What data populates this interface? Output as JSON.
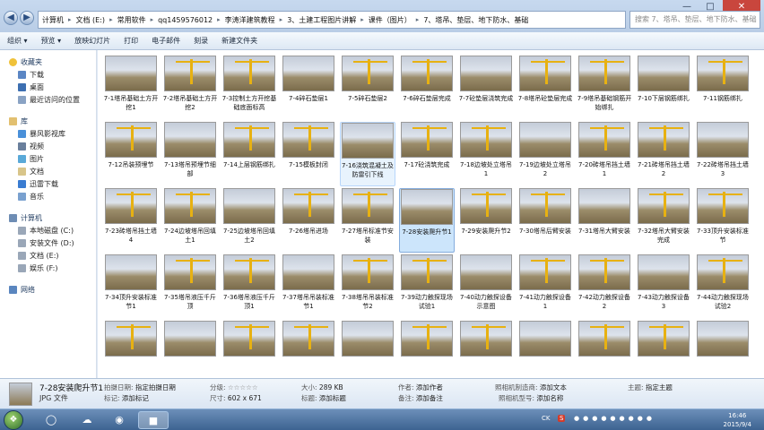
{
  "titlebar": {
    "crumbs": [
      "计算机",
      "文档 (E:)",
      "常用软件",
      "qq1459576012",
      "李涛洋建筑教程",
      "3、土建工程图片讲解",
      "课件（图片）",
      "7、塔吊、垫层、地下防水、基础"
    ],
    "search_placeholder": "搜索 7、塔吊、垫层、地下防水、基础",
    "back_icon": "back-arrow-icon",
    "forward_icon": "forward-arrow-icon"
  },
  "toolbar": {
    "items": [
      "组织 ▾",
      "预览 ▾",
      "放映幻灯片",
      "打印",
      "电子邮件",
      "刻录",
      "新建文件夹"
    ]
  },
  "sidebar": {
    "favorites": {
      "label": "收藏夹",
      "items": [
        "下载",
        "桌面",
        "最近访问的位置"
      ]
    },
    "library": {
      "label": "库",
      "items": [
        "暴风影视库",
        "视频",
        "图片",
        "文档",
        "迅雷下载",
        "音乐"
      ]
    },
    "computer": {
      "label": "计算机",
      "items": [
        "本地磁盘 (C:)",
        "安装文件 (D:)",
        "文档 (E:)",
        "娱乐 (F:)"
      ]
    },
    "network": {
      "label": "网络"
    }
  },
  "files": [
    "7-1塔吊基础土方开挖1",
    "7-2塔吊基础土方开挖2",
    "7-3控制土方开挖基础底面标高",
    "7-4碎石垫层1",
    "7-5碎石垫层2",
    "7-6碎石垫层完成",
    "7-7砼垫层浇筑完成",
    "7-8塔吊砼垫层完成",
    "7-9塔吊基础钢筋开始绑扎",
    "7-10下层钢筋绑扎",
    "7-11钢筋绑扎",
    "7-12吊装预埋节",
    "7-13塔吊预埋节细部",
    "7-14上层钢筋绑扎",
    "7-15模板封闭",
    "7-16浇筑混凝土及防雷引下线",
    "7-17砼浇筑完成",
    "7-18边坡处立塔吊1",
    "7-19边坡处立塔吊2",
    "7-20砖塔吊挡土墙1",
    "7-21砖塔吊挡土墙2",
    "7-22砖塔吊挡土墙3",
    "7-23砖塔吊挡土墙4",
    "7-24边坡塔吊回填土1",
    "7-25边坡塔吊回填土2",
    "7-26塔吊进场",
    "7-27塔吊标准节安装",
    "7-28安装爬升节1",
    "7-29安装爬升节2",
    "7-30塔吊后臂安装",
    "7-31塔吊大臂安装",
    "7-32塔吊大臂安装完成",
    "7-33顶升安装标准节",
    "7-34顶升安装标准节1",
    "7-35塔吊液压千斤顶",
    "7-36塔吊液压千斤顶1",
    "7-37塔吊吊装标准节1",
    "7-38塔吊吊装标准节2",
    "7-39动力触探现场试验1",
    "7-40动力触探设备示意图",
    "7-41动力触探设备1",
    "7-42动力触探设备2",
    "7-43动力触探设备3",
    "7-44动力触探现场试验2",
    "",
    "",
    "",
    "",
    "",
    "",
    "",
    "",
    "",
    "",
    ""
  ],
  "selected_file": "7-28安装爬升节1",
  "details": {
    "filename": "7-28安装爬升节1",
    "filetype": "JPG 文件",
    "shoot_date_label": "拍摄日期:",
    "shoot_date_value": "指定拍摄日期",
    "tags_label": "标记:",
    "tags_value": "添加标记",
    "rating_label": "分级:",
    "rating_value": "☆☆☆☆☆",
    "dims_label": "尺寸:",
    "dims_value": "602 x 671",
    "size_label": "大小:",
    "size_value": "289 KB",
    "title_label": "标题:",
    "title_value": "添加标题",
    "author_label": "作者:",
    "author_value": "添加作者",
    "remark_label": "备注:",
    "remark_value": "添加备注",
    "maker_label": "照相机制造商:",
    "maker_value": "添加文本",
    "model_label": "照相机型号:",
    "model_value": "添加名称",
    "subject_label": "主题:",
    "subject_value": "指定主题"
  },
  "taskbar": {
    "clock_time": "16:46",
    "clock_date": "2015/9/4",
    "ime": "CK",
    "lang": "S"
  },
  "colors": {
    "selection": "#cce5fb",
    "accent": "#3d6391"
  }
}
